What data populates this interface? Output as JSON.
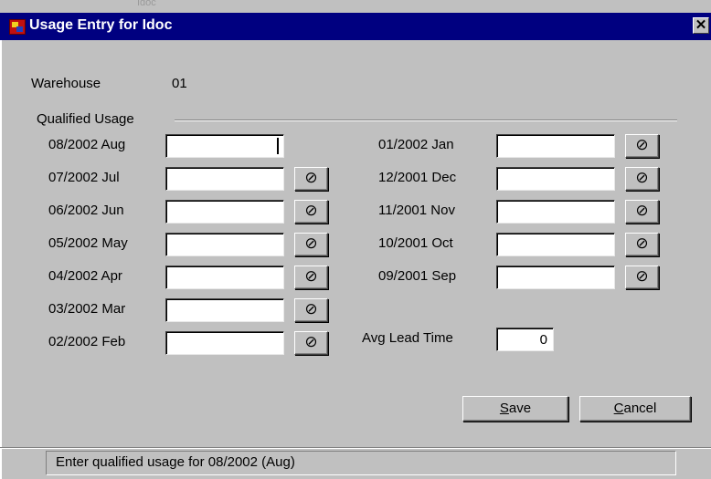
{
  "background_text": "Idoc",
  "window": {
    "title": "Usage Entry for Idoc",
    "close_glyph": "✕"
  },
  "warehouse": {
    "label": "Warehouse",
    "value": "01"
  },
  "group_title": "Qualified Usage",
  "clear_glyph": "⊘",
  "left_rows": [
    {
      "label": "08/2002 Aug",
      "value": "",
      "has_clear": false
    },
    {
      "label": "07/2002 Jul",
      "value": "",
      "has_clear": true
    },
    {
      "label": "06/2002 Jun",
      "value": "",
      "has_clear": true
    },
    {
      "label": "05/2002 May",
      "value": "",
      "has_clear": true
    },
    {
      "label": "04/2002 Apr",
      "value": "",
      "has_clear": true
    },
    {
      "label": "03/2002 Mar",
      "value": "",
      "has_clear": true
    },
    {
      "label": "02/2002 Feb",
      "value": "",
      "has_clear": true
    }
  ],
  "right_rows": [
    {
      "label": "01/2002 Jan",
      "value": "",
      "has_clear": true
    },
    {
      "label": "12/2001 Dec",
      "value": "",
      "has_clear": true
    },
    {
      "label": "11/2001 Nov",
      "value": "",
      "has_clear": true
    },
    {
      "label": "10/2001 Oct",
      "value": "",
      "has_clear": true
    },
    {
      "label": "09/2001 Sep",
      "value": "",
      "has_clear": true
    }
  ],
  "avg_lead_time": {
    "label": "Avg Lead Time",
    "value": "0"
  },
  "buttons": {
    "save": {
      "mnemonic": "S",
      "rest": "ave"
    },
    "cancel": {
      "mnemonic": "C",
      "rest": "ancel"
    }
  },
  "status_text": "Enter qualified usage for 08/2002 (Aug)",
  "colors": {
    "titlebar": "#000080",
    "face": "#c0c0c0"
  }
}
